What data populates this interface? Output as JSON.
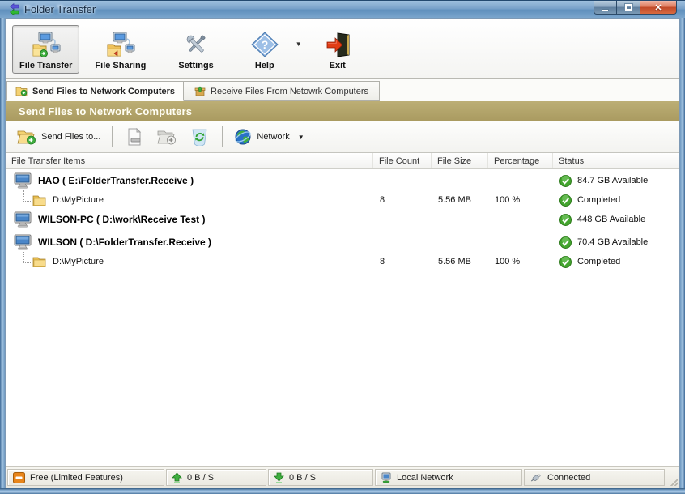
{
  "window": {
    "title": "Folder Transfer"
  },
  "glyphs": {
    "close": "✕",
    "caret_down": "▼",
    "question": "?",
    "check": "✓"
  },
  "colors": {
    "gold_header": "#ac9d66",
    "titlebar_blue": "#7aa2ca",
    "status_green": "#3fa32f",
    "close_red": "#c14a2a"
  },
  "toolbar": {
    "buttons": [
      {
        "label": "File Transfer",
        "icon": "file-transfer-icon",
        "active": true
      },
      {
        "label": "File Sharing",
        "icon": "file-sharing-icon",
        "active": false
      },
      {
        "label": "Settings",
        "icon": "settings-tools-icon",
        "active": false
      },
      {
        "label": "Help",
        "icon": "help-diamond-icon",
        "active": false
      },
      {
        "label": "Exit",
        "icon": "exit-door-icon",
        "active": false
      }
    ]
  },
  "tabs": [
    {
      "label": "Send Files to Network Computers",
      "active": true
    },
    {
      "label": "Receive Files From Netowrk Computers",
      "active": false
    }
  ],
  "section_header": "Send Files to Network Computers",
  "subtoolbar": {
    "send_button_label": "Send Files to...",
    "network_label": "Network"
  },
  "table": {
    "columns": [
      "File Transfer Items",
      "File Count",
      "File Size",
      "Percentage",
      "Status"
    ],
    "rows": [
      {
        "type": "computer",
        "name": "HAO ( E:\\FolderTransfer.Receive )",
        "file_count": "",
        "file_size": "",
        "percentage": "",
        "status": "84.7 GB Available"
      },
      {
        "type": "folder",
        "name": "D:\\MyPicture",
        "file_count": "8",
        "file_size": "5.56 MB",
        "percentage": "100 %",
        "status": "Completed"
      },
      {
        "type": "computer",
        "name": "WILSON-PC ( D:\\work\\Receive Test )",
        "file_count": "",
        "file_size": "",
        "percentage": "",
        "status": "448 GB Available"
      },
      {
        "type": "computer",
        "name": "WILSON ( D:\\FolderTransfer.Receive )",
        "file_count": "",
        "file_size": "",
        "percentage": "",
        "status": "70.4 GB Available"
      },
      {
        "type": "folder",
        "name": "D:\\MyPicture",
        "file_count": "8",
        "file_size": "5.56 MB",
        "percentage": "100 %",
        "status": "Completed"
      }
    ]
  },
  "statusbar": {
    "license": "Free (Limited Features)",
    "upload_speed": "0 B / S",
    "download_speed": "0 B / S",
    "network": "Local Network",
    "connection": "Connected"
  }
}
